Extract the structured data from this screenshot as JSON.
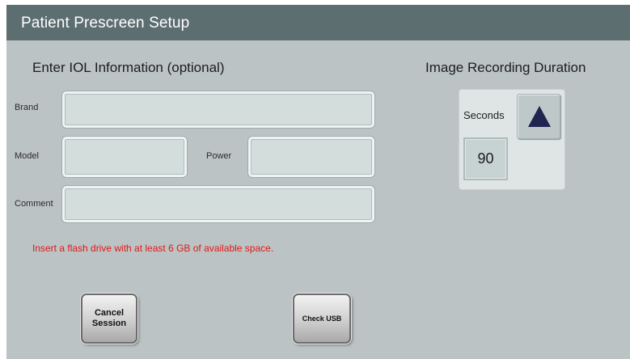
{
  "title": "Patient Prescreen Setup",
  "iol_section": {
    "heading": "Enter IOL Information (optional)",
    "fields": {
      "brand": {
        "label": "Brand",
        "value": ""
      },
      "model": {
        "label": "Model",
        "value": ""
      },
      "power": {
        "label": "Power",
        "value": ""
      },
      "comment": {
        "label": "Comment",
        "value": ""
      }
    }
  },
  "warning": "Insert a flash drive with at least 6 GB of available space.",
  "recording": {
    "heading": "Image Recording Duration",
    "seconds_label": "Seconds",
    "seconds_value": "90",
    "up_icon": "triangle-up-icon"
  },
  "buttons": {
    "cancel_line1": "Cancel",
    "cancel_line2": "Session",
    "check_usb": "Check USB"
  },
  "colors": {
    "titlebar": "#5d6e70",
    "background": "#bcc3c4",
    "warning": "#e01818",
    "arrow": "#1f2450"
  }
}
